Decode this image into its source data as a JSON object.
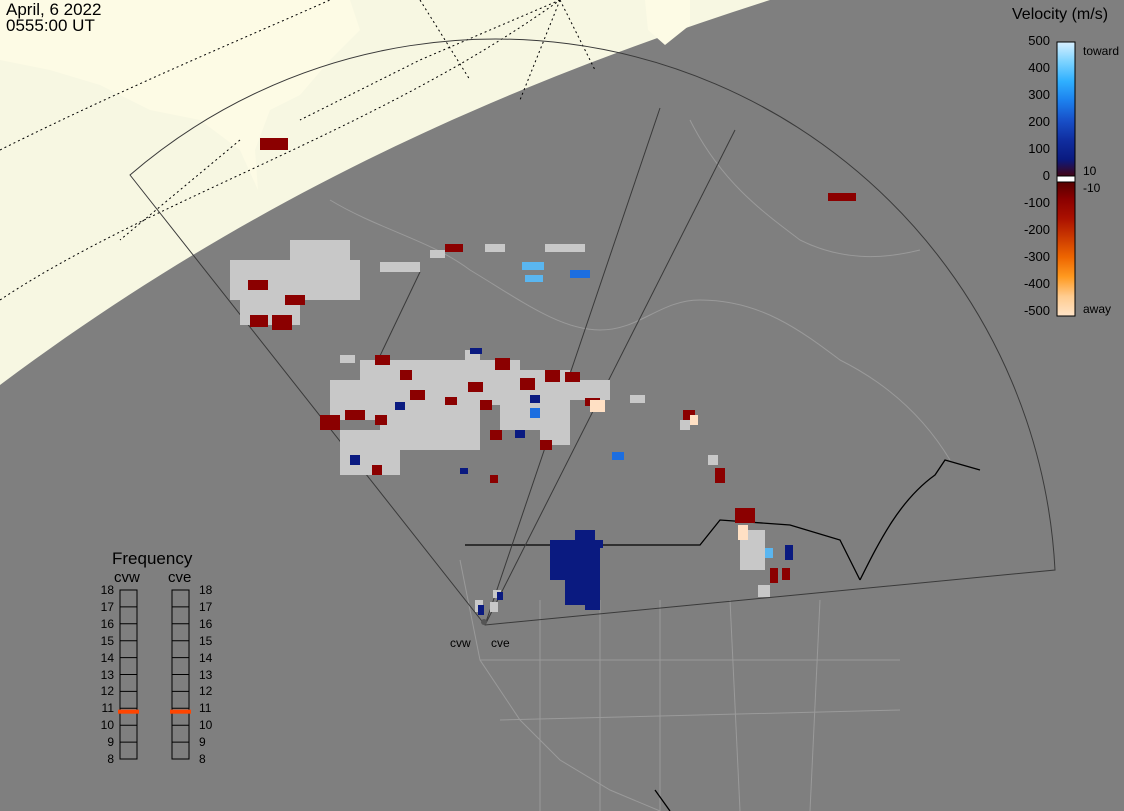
{
  "header": {
    "date": "April, 6 2022",
    "time": "0555:00 UT"
  },
  "colors": {
    "background": "#7f7f7f",
    "daylight": "#f7f7e2",
    "land": "#fdfbe5",
    "ground_scatter": "#c8c8c8",
    "frequency_marker": "#ff4500"
  },
  "legend": {
    "title": "Velocity (m/s)",
    "ticks": [
      "500",
      "400",
      "300",
      "200",
      "100",
      "0",
      "-100",
      "-200",
      "-300",
      "-400",
      "-500"
    ],
    "toward_label": "toward",
    "away_label": "away",
    "small_plus": "10",
    "small_minus": "-10",
    "gradient": [
      "#d8f0ff",
      "#7dd3ff",
      "#2fb0ff",
      "#1c80ee",
      "#1850c8",
      "#102ea0",
      "#0a1a80",
      "#4d0000",
      "#8a0000",
      "#aa1000",
      "#cc3a00",
      "#ee6600",
      "#ff9a20",
      "#ffcc90",
      "#ffe4c8"
    ]
  },
  "frequency": {
    "title": "Frequency",
    "radars": [
      {
        "name": "cvw",
        "value_mhz": 10.8
      },
      {
        "name": "cve",
        "value_mhz": 10.8
      }
    ],
    "scale": [
      "18",
      "17",
      "16",
      "15",
      "14",
      "13",
      "12",
      "11",
      "10",
      "9",
      "8"
    ]
  },
  "radar_labels": [
    "cvw",
    "cve"
  ]
}
